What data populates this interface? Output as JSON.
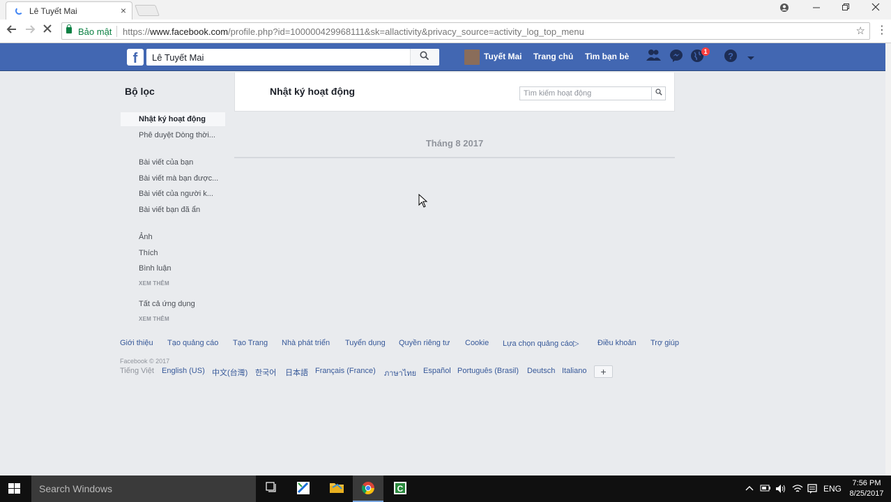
{
  "browser": {
    "tab_title": "Lê Tuyết Mai",
    "tab_close": "×",
    "secure_label": "Bảo mật",
    "url_scheme": "https://",
    "url_host": "www.facebook.com",
    "url_path": "/profile.php?id=100000429968111&sk=allactivity&privacy_source=activity_log_top_menu"
  },
  "fb": {
    "logo": "f",
    "search_value": "Lê Tuyết Mai",
    "profile_name": "Tuyết Mai",
    "home": "Trang chủ",
    "find_friends": "Tìm bạn bè",
    "notifications_count": "1"
  },
  "filter": {
    "title": "Bộ lọc",
    "items": [
      "Nhật ký hoạt động",
      "Phê duyệt Dòng thời...",
      "Bài viết của bạn",
      "Bài viết mà bạn được...",
      "Bài viết của người k...",
      "Bài viết bạn đã ẩn",
      "Ảnh",
      "Thích",
      "Bình luận",
      "Tất cả ứng dụng"
    ],
    "see_more": "XEM THÊM"
  },
  "activity": {
    "title": "Nhật ký hoạt động",
    "search_placeholder": "Tìm kiếm hoạt động",
    "month": "Tháng 8 2017"
  },
  "footer": {
    "links": [
      "Giới thiệu",
      "Tạo quảng cáo",
      "Tạo Trang",
      "Nhà phát triển",
      "Tuyển dụng",
      "Quyền riêng tư",
      "Cookie",
      "Lựa chọn quảng cáo",
      "Điều khoản",
      "Trợ giúp"
    ],
    "copyright": "Facebook © 2017",
    "languages": [
      "Tiếng Việt",
      "English (US)",
      "中文(台灣)",
      "한국어",
      "日本語",
      "Français (France)",
      "ภาษาไทย",
      "Español",
      "Português (Brasil)",
      "Deutsch",
      "Italiano"
    ],
    "add_language": "+"
  },
  "taskbar": {
    "search_placeholder": "Search Windows",
    "language": "ENG",
    "time": "7:56 PM",
    "date": "8/25/2017"
  }
}
